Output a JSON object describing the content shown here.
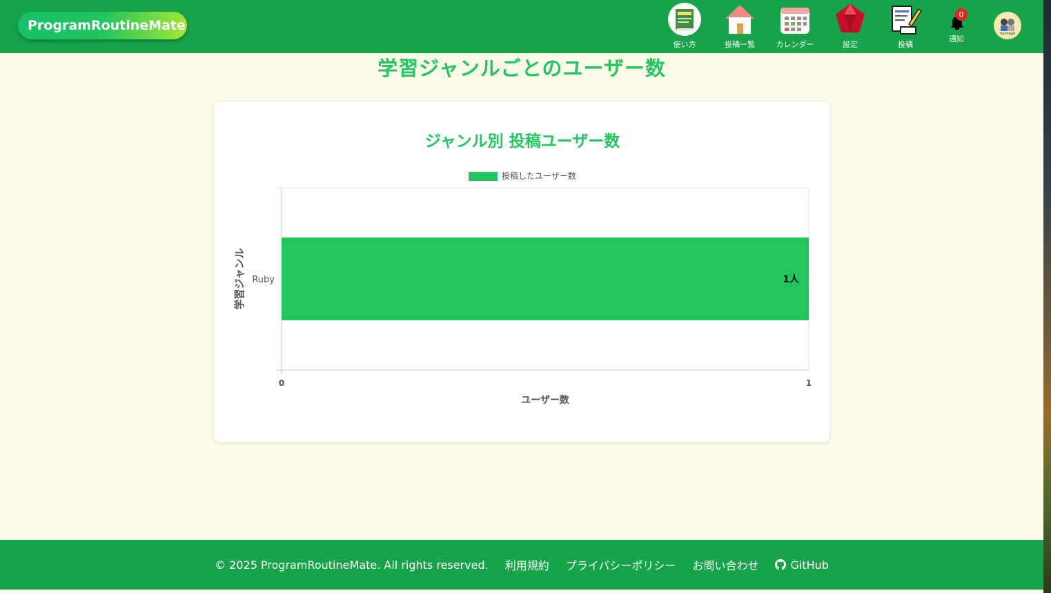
{
  "header": {
    "logo": "ProgramRoutineMate",
    "nav": [
      {
        "label": "使い方",
        "icon": "guide-book-icon"
      },
      {
        "label": "投稿一覧",
        "icon": "home-icon"
      },
      {
        "label": "カレンダー",
        "icon": "calendar-icon"
      },
      {
        "label": "設定",
        "icon": "ruby-gem-icon"
      },
      {
        "label": "投稿",
        "icon": "write-post-icon"
      }
    ],
    "notifications": {
      "label": "通知",
      "count": "0"
    },
    "avatar_text": "noimage"
  },
  "main": {
    "page_title": "学習ジャンルごとのユーザー数"
  },
  "chart_data": {
    "type": "bar",
    "orientation": "horizontal",
    "title": "ジャンル別 投稿ユーザー数",
    "categories": [
      "Ruby"
    ],
    "series": [
      {
        "name": "投稿したユーザー数",
        "values": [
          1
        ],
        "color": "#22c55e"
      }
    ],
    "data_labels": [
      "1人"
    ],
    "xlabel": "ユーザー数",
    "ylabel": "学習ジャンル",
    "xlim": [
      0,
      1
    ],
    "x_ticks": [
      "0",
      "1"
    ],
    "legend_position": "top",
    "grid": false
  },
  "footer": {
    "copyright": "© 2025 ProgramRoutineMate. All rights reserved.",
    "links": [
      "利用規約",
      "プライバシーポリシー",
      "お問い合わせ",
      "GitHub"
    ]
  },
  "colors": {
    "header_bg": "#16a34a",
    "accent": "#22c55e",
    "page_bg": "#fefbe8",
    "badge": "#dc2626"
  }
}
